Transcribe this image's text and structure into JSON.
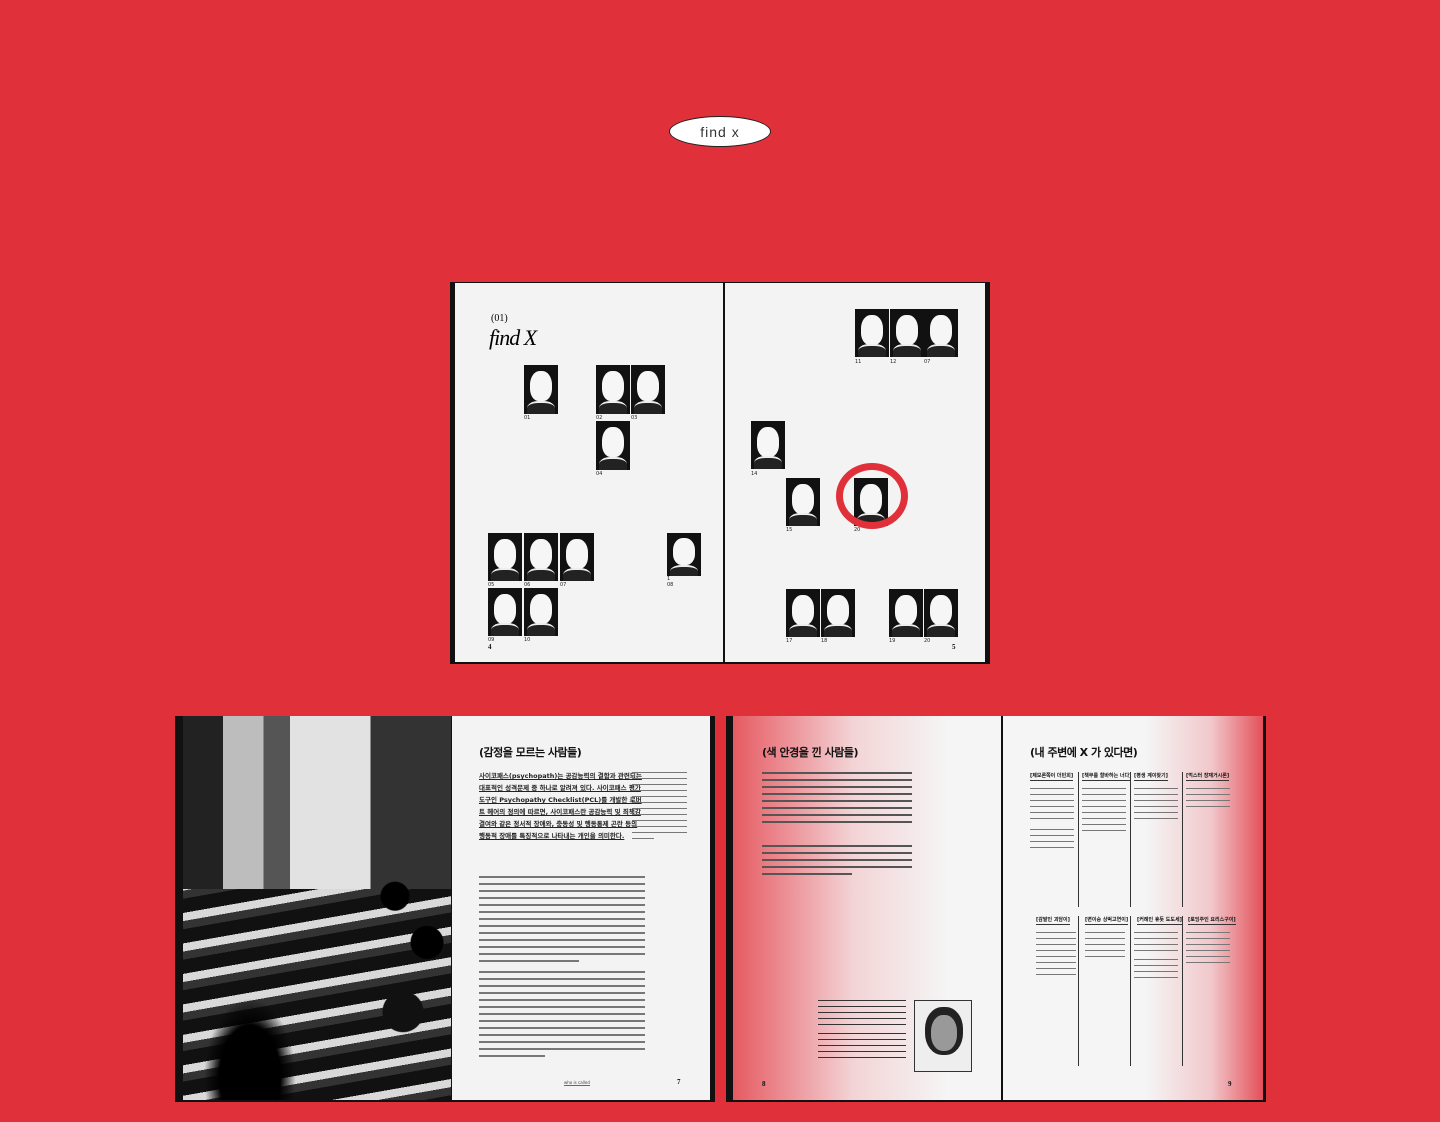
{
  "header": {
    "pill_label": "find x"
  },
  "spread_top": {
    "left": {
      "issue": "(01)",
      "title": "find X",
      "photo_numbers": [
        "01",
        "02",
        "03",
        "04",
        "05",
        "06",
        "07",
        "08",
        "09",
        "10"
      ],
      "folio": "4",
      "small_label": "1"
    },
    "right": {
      "photo_numbers": [
        "11",
        "12",
        "07",
        "14",
        "15",
        "20",
        "17",
        "18",
        "19",
        "20"
      ],
      "folio": "5"
    }
  },
  "spread_bottom_left": {
    "section_title": "(감정을 모르는 사람들)",
    "lead": "사이코패스(psychopath)는 공감능력의 결함과 관련되는 대표적인 성격문제 중 하나로 알려져 있다. 사이코패스 평가도구인 Psychopathy Checklist(PCL)를 개발한 로버트 헤어의 정의에 따르면, 사이코패스란 공감능력 및 죄책감 결여와 같은 정서적 장애와, 충동성 및 행동통제 곤란 등의 행동적 장애를 특징적으로 나타내는 개인을 의미한다.",
    "footer_label": "who is called",
    "folio": "7"
  },
  "spread_bottom_right": {
    "left_title": "(색 안경을 낀 사람들)",
    "right_title": "(내 주변에 X 가 있다면)",
    "columns_top": [
      "[제모론쪽이 더빈희]",
      "[책무를 할바하는 너다]",
      "[평생 계이찾기]",
      "[먹스터 장재거시론]"
    ],
    "columns_bottom": [
      "[감발인 괴담이]",
      "[변이숭 상벅고연이]",
      "[커례인 휴듯 도도세]",
      "[로잉주인 요리스구이]"
    ],
    "folio_left": "8",
    "folio_right": "9"
  }
}
